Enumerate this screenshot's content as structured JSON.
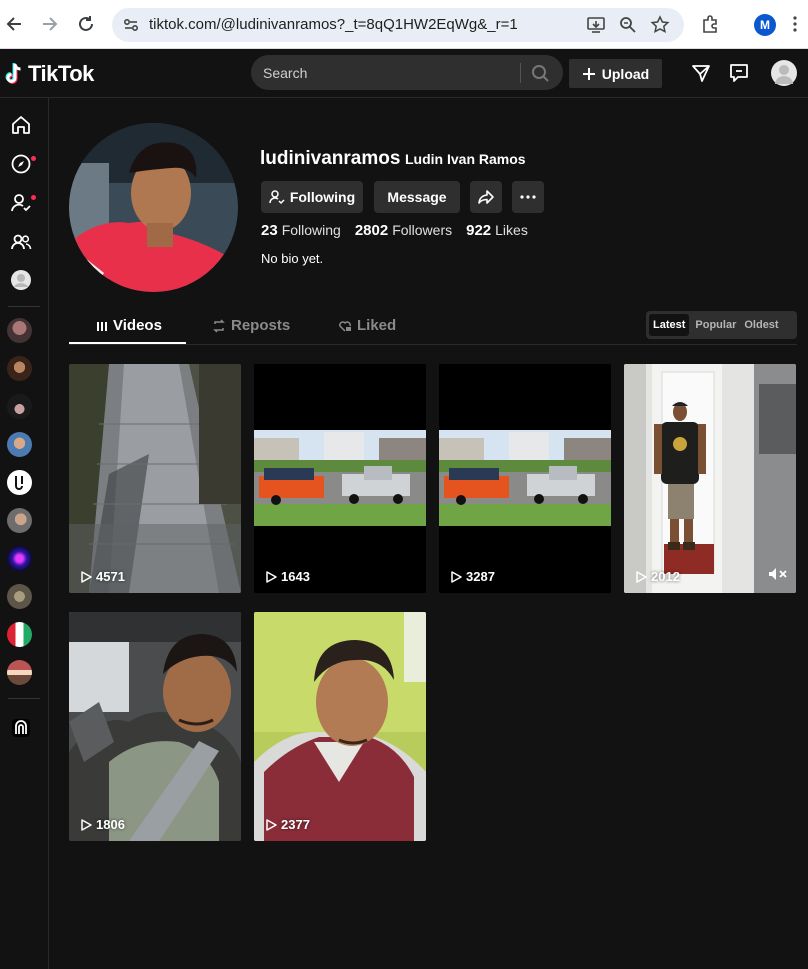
{
  "browser": {
    "url": "tiktok.com/@ludinivanramos?_t=8qQ1HW2EqWg&_r=1",
    "profile_initial": "M"
  },
  "header": {
    "logo_text": "TikTok",
    "search_placeholder": "Search",
    "upload_label": "Upload"
  },
  "profile": {
    "username": "ludinivanramos",
    "display_name": "Ludin Ivan Ramos",
    "following_button": "Following",
    "message_button": "Message",
    "stats": {
      "following_count": "23",
      "following_label": "Following",
      "followers_count": "2802",
      "followers_label": "Followers",
      "likes_count": "922",
      "likes_label": "Likes"
    },
    "bio": "No bio yet."
  },
  "tabs": {
    "videos": "Videos",
    "reposts": "Reposts",
    "liked": "Liked"
  },
  "sort": {
    "latest": "Latest",
    "popular": "Popular",
    "oldest": "Oldest",
    "selected": "Latest"
  },
  "videos": [
    {
      "views": "4571",
      "subject": "paver walkway"
    },
    {
      "views": "1643",
      "subject": "truck with trailer"
    },
    {
      "views": "3287",
      "subject": "truck with trailer"
    },
    {
      "views": "2012",
      "subject": "man in doorway",
      "muted": true
    },
    {
      "views": "1806",
      "subject": "selfie in car"
    },
    {
      "views": "2377",
      "subject": "selfie maroon vest"
    }
  ],
  "colors": {
    "background": "#121212",
    "surface": "#2f2f2f",
    "accent_red": "#fe2c55",
    "tiktok_cyan": "#25f4ee"
  }
}
